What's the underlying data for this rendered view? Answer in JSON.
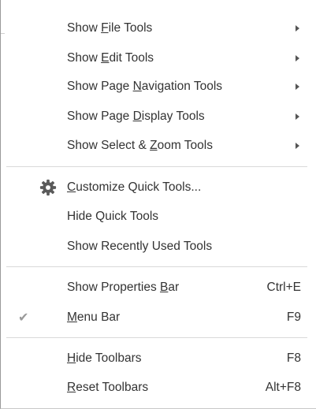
{
  "menu": {
    "show_file_tools": {
      "pre": "Show ",
      "key": "F",
      "post": "ile Tools"
    },
    "show_edit_tools": {
      "pre": "Show ",
      "key": "E",
      "post": "dit Tools"
    },
    "show_page_nav_tools": {
      "pre": "Show Page ",
      "key": "N",
      "post": "avigation Tools"
    },
    "show_page_display_tools": {
      "pre": "Show Page ",
      "key": "D",
      "post": "isplay Tools"
    },
    "show_select_zoom_tools": {
      "pre": "Show Select & ",
      "key": "Z",
      "post": "oom Tools"
    },
    "customize_quick_tools": {
      "pre": "",
      "key": "C",
      "post": "ustomize Quick Tools..."
    },
    "hide_quick_tools": {
      "label": "Hide Quick Tools"
    },
    "show_recently_used_tools": {
      "label": "Show Recently Used Tools"
    },
    "show_properties_bar": {
      "pre": "Show Properties ",
      "key": "B",
      "post": "ar",
      "shortcut": "Ctrl+E"
    },
    "menu_bar": {
      "pre": "",
      "key": "M",
      "post": "enu Bar",
      "shortcut": "F9",
      "checked": true
    },
    "hide_toolbars": {
      "pre": "",
      "key": "H",
      "post": "ide Toolbars",
      "shortcut": "F8"
    },
    "reset_toolbars": {
      "pre": "",
      "key": "R",
      "post": "eset Toolbars",
      "shortcut": "Alt+F8"
    }
  },
  "icons": {
    "customize": "gear-icon",
    "submenu": "submenu-arrow-icon",
    "check": "checkmark-icon"
  },
  "glyphs": {
    "check": "✔"
  }
}
